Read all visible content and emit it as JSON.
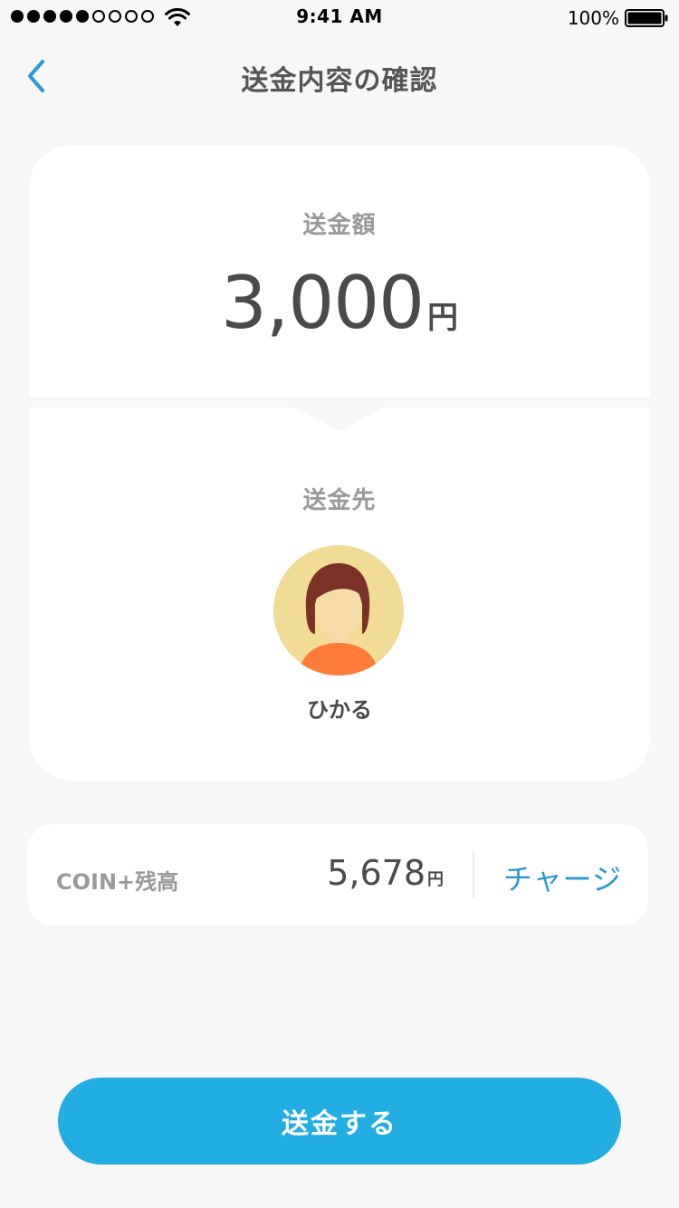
{
  "status_bar": {
    "time": "9:41 AM",
    "battery_percent": "100%",
    "signal_bars_filled": 5,
    "signal_bars_total": 9,
    "icons": [
      "signal-dots-icon",
      "wifi-icon",
      "battery-icon"
    ]
  },
  "nav": {
    "back_icon": "chevron-left-icon",
    "title": "送金内容の確認"
  },
  "transfer": {
    "amount_label": "送金額",
    "amount_value": "3,000",
    "amount_unit": "円",
    "recipient_label": "送金先",
    "recipient_name": "ひかる",
    "avatar_icon": "user-avatar-icon"
  },
  "balance": {
    "label": "COIN+残高",
    "value": "5,678",
    "unit": "円",
    "charge_label": "チャージ"
  },
  "actions": {
    "send_label": "送金する"
  },
  "colors": {
    "accent": "#22ade3",
    "link": "#2a97d1",
    "background": "#f7f7f7",
    "card": "#ffffff",
    "text_primary": "#4a4a4a",
    "text_secondary": "#999999"
  }
}
